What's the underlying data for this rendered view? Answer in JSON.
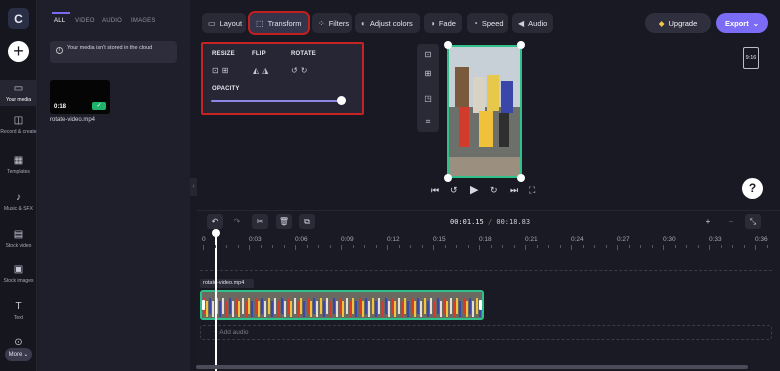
{
  "app": {
    "logo_letter": "C"
  },
  "rail": {
    "items": [
      {
        "label": "Your media",
        "icon": "folder-icon"
      },
      {
        "label": "Record & create",
        "icon": "camera-icon"
      },
      {
        "label": "Templates",
        "icon": "templates-icon"
      },
      {
        "label": "Music & SFX",
        "icon": "music-icon"
      },
      {
        "label": "Stock video",
        "icon": "film-icon"
      },
      {
        "label": "Stock images",
        "icon": "image-icon"
      },
      {
        "label": "Text",
        "icon": "text-icon"
      },
      {
        "label": "More",
        "icon": "chevron-down-icon"
      }
    ]
  },
  "media_panel": {
    "tabs": [
      "ALL",
      "VIDEO",
      "AUDIO",
      "IMAGES"
    ],
    "active_tab": "ALL",
    "notice": "Your media isn't stored in the cloud",
    "asset": {
      "name": "rotate-video.mp4",
      "duration": "0:18"
    }
  },
  "toolbar": {
    "layout": "Layout",
    "transform": "Transform",
    "filters": "Filters",
    "adjust_colors": "Adjust colors",
    "fade": "Fade",
    "speed": "Speed",
    "audio": "Audio",
    "upgrade": "Upgrade",
    "export": "Export"
  },
  "transform_panel": {
    "resize": "RESIZE",
    "flip": "FLIP",
    "rotate": "ROTATE",
    "opacity": "OPACITY",
    "opacity_value": 1.0
  },
  "preview": {
    "aspect_ratio": "9:16"
  },
  "timeline": {
    "timecode_current": "00:01.15",
    "timecode_total": "00:18.83",
    "ticks": [
      "0",
      "0:03",
      "0:06",
      "0:09",
      "0:12",
      "0:15",
      "0:18",
      "0:21",
      "0:24",
      "0:27",
      "0:30",
      "0:33",
      "0:36"
    ],
    "clip_name": "rotate-video.mp4",
    "add_audio": "+ Add audio"
  },
  "help": "?",
  "colors": {
    "accent": "#7b6cf6",
    "selection_outline": "#c62424",
    "clip_border": "#32c08a",
    "background": "#191923"
  }
}
